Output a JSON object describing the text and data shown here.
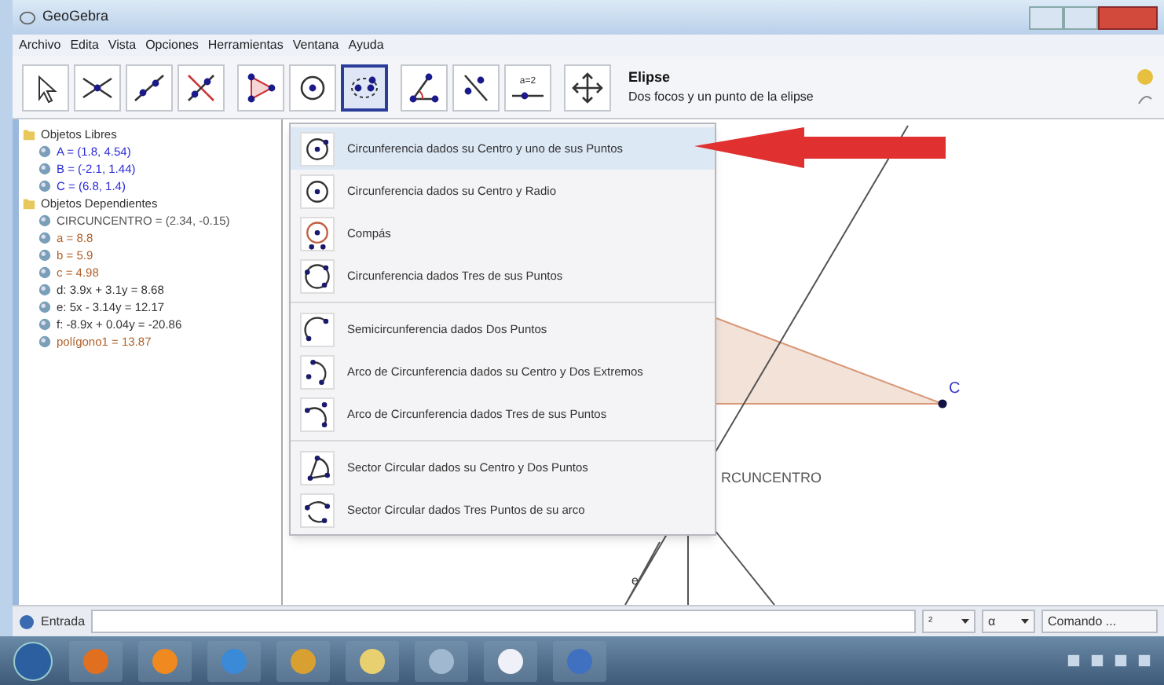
{
  "window": {
    "title": "GeoGebra"
  },
  "menu": [
    "Archivo",
    "Edita",
    "Vista",
    "Opciones",
    "Herramientas",
    "Ventana",
    "Ayuda"
  ],
  "toolbar": {
    "tools": [
      {
        "kind": "pointer",
        "selected": false
      },
      {
        "kind": "intersect",
        "selected": false
      },
      {
        "kind": "line",
        "selected": false
      },
      {
        "kind": "perpendicular",
        "selected": false
      },
      {
        "kind": "polygon",
        "selected": false
      },
      {
        "kind": "circle",
        "selected": false
      },
      {
        "kind": "conic",
        "selected": true
      },
      {
        "kind": "angle",
        "selected": false
      },
      {
        "kind": "reflect",
        "selected": false
      },
      {
        "kind": "slider",
        "selected": false,
        "label": "a=2"
      },
      {
        "kind": "move",
        "selected": false
      }
    ],
    "info": {
      "title": "Elipse",
      "description": "Dos focos y un punto de la elipse"
    }
  },
  "algebra": [
    {
      "label": "Objetos Libres",
      "children": [
        {
          "text": "A = (1.8, 4.54)",
          "color": "#2a2ad8"
        },
        {
          "text": "B = (-2.1, 1.44)",
          "color": "#2a2ad8"
        },
        {
          "text": "C = (6.8, 1.4)",
          "color": "#2a2ad8"
        }
      ]
    },
    {
      "label": "Objetos Dependientes",
      "children": [
        {
          "text": "CIRCUNCENTRO = (2.34, -0.15)",
          "color": "#555555"
        },
        {
          "text": "a = 8.8",
          "color": "#b0602a"
        },
        {
          "text": "b = 5.9",
          "color": "#b0602a"
        },
        {
          "text": "c = 4.98",
          "color": "#b0602a"
        },
        {
          "text": "d: 3.9x + 3.1y = 8.68",
          "color": "#333333"
        },
        {
          "text": "e: 5x - 3.14y = 12.17",
          "color": "#333333"
        },
        {
          "text": "f: -8.9x + 0.04y = -20.86",
          "color": "#333333"
        },
        {
          "text": "polígono1 = 13.87",
          "color": "#b0602a"
        }
      ]
    }
  ],
  "dropdown": [
    [
      {
        "kind": "center-point",
        "label": "Circunferencia dados su Centro y uno de sus Puntos",
        "selected": true
      },
      {
        "kind": "center-radius",
        "label": "Circunferencia dados su Centro y Radio",
        "selected": false
      },
      {
        "kind": "compass",
        "label": "Compás",
        "selected": false
      },
      {
        "kind": "three-points",
        "label": "Circunferencia dados Tres de sus Puntos",
        "selected": false
      }
    ],
    [
      {
        "kind": "semicircle",
        "label": "Semicircunferencia dados Dos Puntos",
        "selected": false
      },
      {
        "kind": "arc-center",
        "label": "Arco de Circunferencia dados su Centro y Dos Extremos",
        "selected": false
      },
      {
        "kind": "arc-three",
        "label": "Arco de Circunferencia dados Tres de sus Puntos",
        "selected": false
      }
    ],
    [
      {
        "kind": "sector-center",
        "label": "Sector Circular dados su Centro y Dos Puntos",
        "selected": false
      },
      {
        "kind": "sector-three",
        "label": "Sector Circular dados Tres Puntos de su arco",
        "selected": false
      }
    ]
  ],
  "graphics": {
    "labels": [
      {
        "kind": "point",
        "text": "C"
      },
      {
        "kind": "name",
        "text": "RCUNCENTRO"
      },
      {
        "kind": "line",
        "text": "e"
      }
    ]
  },
  "input": {
    "label": "Entrada",
    "symbols": [
      "²",
      "α"
    ],
    "command": "Comando ..."
  }
}
